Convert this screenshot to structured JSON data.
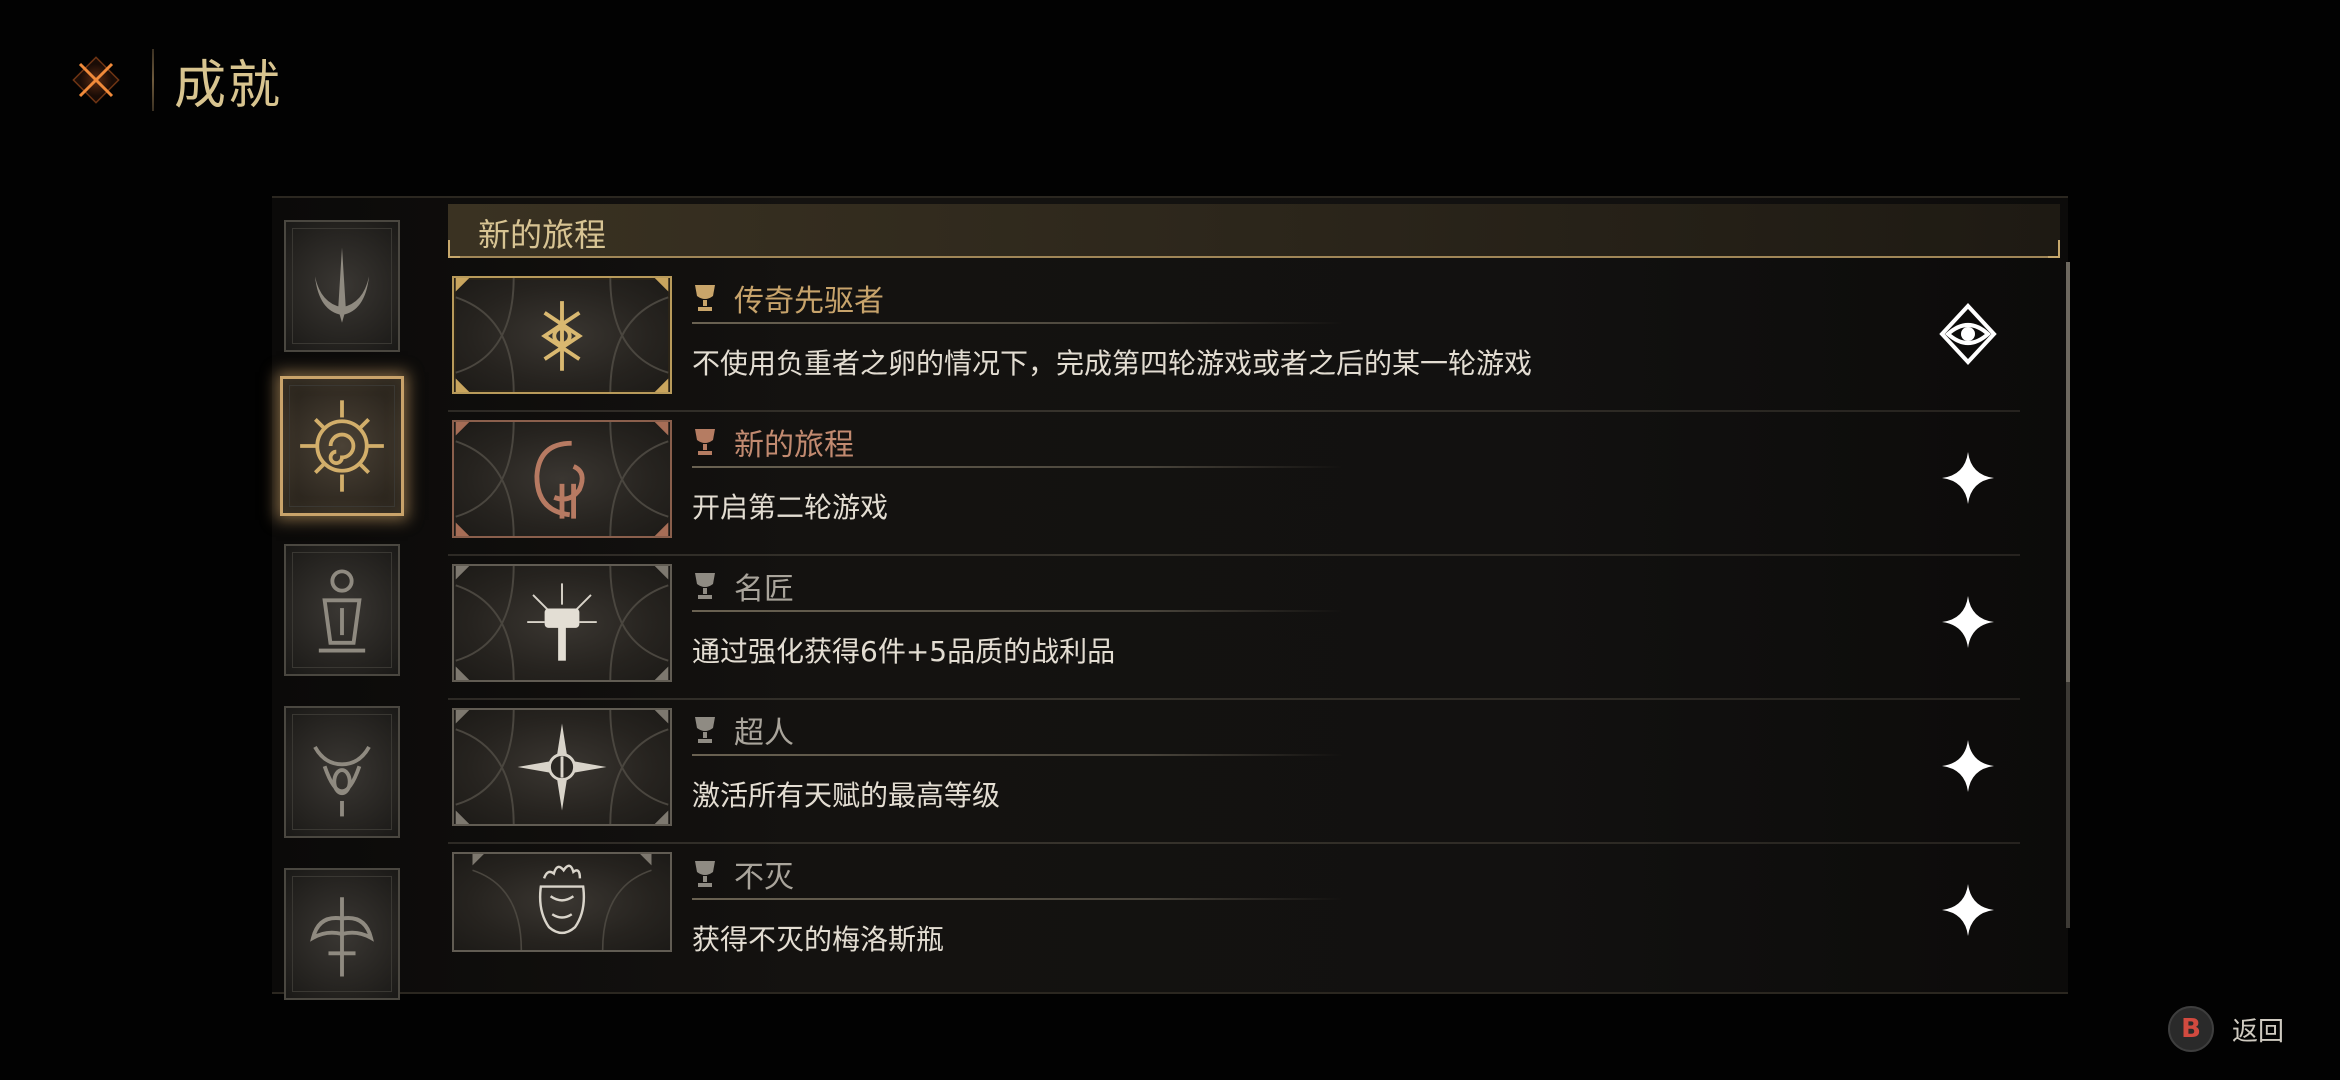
{
  "header": {
    "title": "成就",
    "close_icon": "close-x-icon"
  },
  "categories": [
    {
      "icon": "crescent-spire-icon",
      "active": false
    },
    {
      "icon": "spiral-sun-icon",
      "active": true
    },
    {
      "icon": "lantern-shrine-icon",
      "active": false
    },
    {
      "icon": "horned-mask-icon",
      "active": false
    },
    {
      "icon": "winged-sword-icon",
      "active": false
    }
  ],
  "section": {
    "title": "新的旅程"
  },
  "achievements": [
    {
      "title": "传奇先驱者",
      "description": "不使用负重者之卵的情况下，完成第四轮游戏或者之后的某一轮游戏",
      "tier": "gold",
      "status_icon": "eye-emblem-icon"
    },
    {
      "title": "新的旅程",
      "description": "开启第二轮游戏",
      "tier": "copper",
      "status_icon": "sparkle-star-icon"
    },
    {
      "title": "名匠",
      "description": "通过强化获得6件+5品质的战利品",
      "tier": "silver",
      "status_icon": "sparkle-star-icon"
    },
    {
      "title": "超人",
      "description": "激活所有天赋的最高等级",
      "tier": "silver",
      "status_icon": "sparkle-star-icon"
    },
    {
      "title": "不灭",
      "description": "获得不灭的梅洛斯瓶",
      "tier": "silver",
      "status_icon": "sparkle-star-icon"
    }
  ],
  "footer": {
    "button_glyph": "B",
    "back_label": "返回"
  },
  "colors": {
    "gold": "#c7a36b",
    "copper": "#c28a70",
    "silver": "#a9a49b",
    "accent_orange": "#e0742e"
  }
}
